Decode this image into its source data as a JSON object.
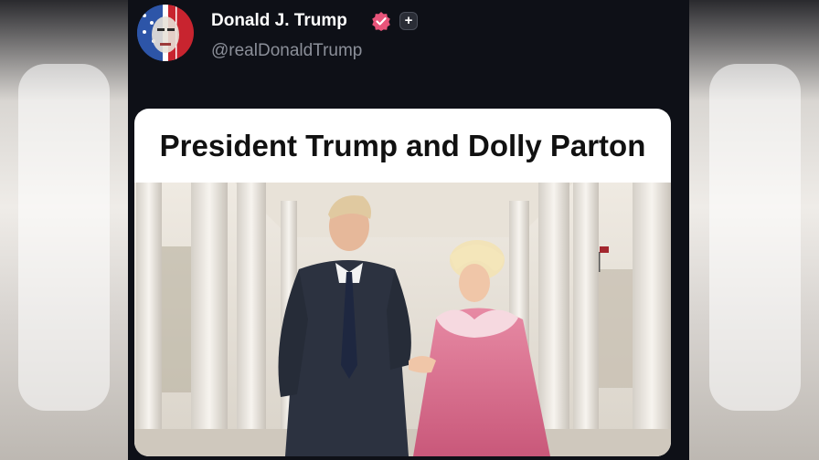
{
  "post": {
    "author_name": "Donald J. Trump",
    "handle": "@realDonaldTrump",
    "follow_button": "+"
  },
  "card": {
    "headline": "President Trump and Dolly Parton"
  },
  "colors": {
    "background": "#0e1017",
    "verified_badge": "#e8547a",
    "headline_text": "#111111",
    "card_background": "#ffffff"
  },
  "icons": {
    "verified": "verified-badge-icon",
    "plus": "plus-icon"
  }
}
